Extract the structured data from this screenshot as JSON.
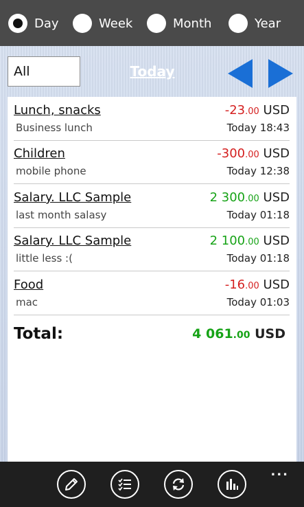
{
  "period_selector": {
    "options": [
      {
        "label": "Day",
        "selected": true
      },
      {
        "label": "Week",
        "selected": false
      },
      {
        "label": "Month",
        "selected": false
      },
      {
        "label": "Year",
        "selected": false
      }
    ]
  },
  "toolbar": {
    "filter_value": "All",
    "date_label": "Today",
    "prev_icon": "arrow-left-icon",
    "next_icon": "arrow-right-icon"
  },
  "transactions": [
    {
      "title": "Lunch, snacks",
      "note": "Business lunch",
      "amount_main": "-23",
      "amount_cents": ".00",
      "currency": "USD",
      "time": "Today 18:43",
      "type": "expense"
    },
    {
      "title": "Children",
      "note": "mobile phone",
      "amount_main": "-300",
      "amount_cents": ".00",
      "currency": "USD",
      "time": "Today 12:38",
      "type": "expense"
    },
    {
      "title": "Salary. LLC Sample",
      "note": "last month salasy",
      "amount_main": "2 300",
      "amount_cents": ".00",
      "currency": "USD",
      "time": "Today 01:18",
      "type": "income"
    },
    {
      "title": "Salary. LLC Sample",
      "note": "little less :(",
      "amount_main": "2 100",
      "amount_cents": ".00",
      "currency": "USD",
      "time": "Today 01:18",
      "type": "income"
    },
    {
      "title": "Food",
      "note": "mac",
      "amount_main": "-16",
      "amount_cents": ".00",
      "currency": "USD",
      "time": "Today 01:03",
      "type": "expense"
    }
  ],
  "total": {
    "label": "Total:",
    "amount_main": "4 061",
    "amount_cents": ".00",
    "currency": "USD"
  },
  "app_bar": {
    "buttons": [
      "edit-icon",
      "list-icon",
      "sync-icon",
      "chart-icon"
    ],
    "more_label": "..."
  },
  "colors": {
    "expense": "#d42020",
    "income": "#17a317",
    "accent_arrow": "#1a6fd6",
    "topbar": "#4a4a4a",
    "appbar": "#1f1f1f"
  }
}
